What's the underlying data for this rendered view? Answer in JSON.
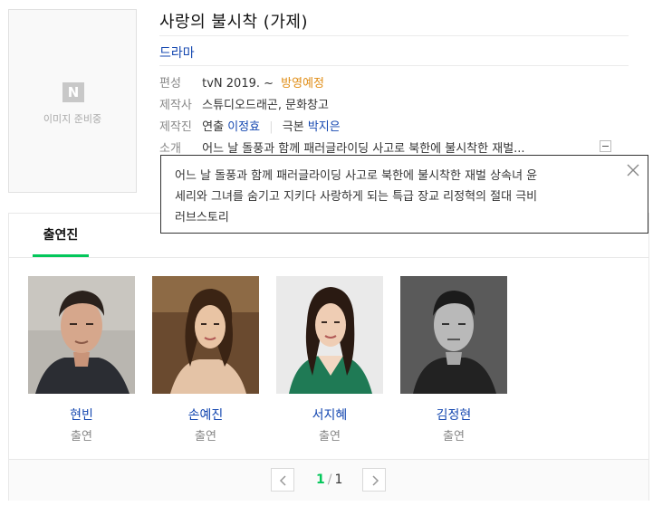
{
  "poster": {
    "placeholder_text": "이미지 준비중",
    "logo_letter": "N"
  },
  "title": "사랑의 불시착 (가제)",
  "genre": "드라마",
  "broadcast": {
    "label": "편성",
    "channel_date": "tvN 2019. ~",
    "status": "방영예정"
  },
  "producer": {
    "label": "제작사",
    "value": "스튜디오드래곤, 문화창고"
  },
  "staff": {
    "label": "제작진",
    "director_role": "연출",
    "director_name": "이정효",
    "writer_role": "극본",
    "writer_name": "박지은"
  },
  "intro": {
    "label": "소개",
    "summary": "어느 날 돌풍과 함께 패러글라이딩 사고로 북한에 불시착한 재벌...",
    "full_lines": [
      "어느 날 돌풍과 함께 패러글라이딩 사고로 북한에 불시착한 재벌 상속녀 윤",
      "세리와 그녀를 숨기고 지키다 사랑하게 되는 특급 장교 리정혁의 절대 극비",
      "러브스토리"
    ]
  },
  "cast_tab": "출연진",
  "cast": [
    {
      "name": "현빈",
      "role": "출연"
    },
    {
      "name": "손예진",
      "role": "출연"
    },
    {
      "name": "서지혜",
      "role": "출연"
    },
    {
      "name": "김정현",
      "role": "출연"
    }
  ],
  "pagination": {
    "current": "1",
    "separator": "/",
    "total": "1"
  },
  "colors": {
    "link_blue": "#1447b0",
    "accent_green": "#03c75a",
    "status_orange": "#e08d16"
  },
  "icons": {
    "close": "close-icon",
    "collapse": "collapse-icon",
    "prev": "chevron-left-icon",
    "next": "chevron-right-icon"
  }
}
